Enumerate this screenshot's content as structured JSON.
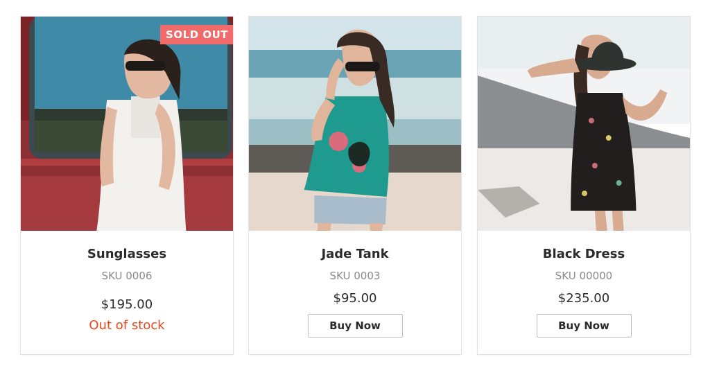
{
  "products": [
    {
      "name": "Sunglasses",
      "sku": "SKU 0006",
      "price": "$195.00",
      "badge": "SOLD OUT",
      "stock_status": "Out of stock",
      "image": "woman-in-white-dress-beside-red-van"
    },
    {
      "name": "Jade Tank",
      "sku": "SKU 0003",
      "price": "$95.00",
      "button_label": "Buy Now",
      "image": "woman-in-teal-floral-tank-on-beach"
    },
    {
      "name": "Black Dress",
      "sku": "SKU 00000",
      "price": "$235.00",
      "button_label": "Buy Now",
      "image": "woman-in-black-floral-dress-with-hat-on-beach"
    }
  ],
  "colors": {
    "badge_bg": "#f26a6a",
    "out_of_stock_text": "#e8481d",
    "title_text": "#2b2b2b",
    "sku_text": "#8a8a8a",
    "card_border": "#e2e2e2"
  }
}
